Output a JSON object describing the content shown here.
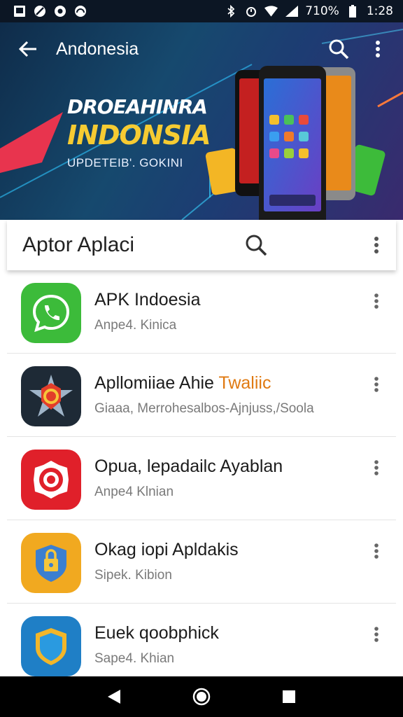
{
  "status_bar": {
    "battery": "710%",
    "time": "1:28"
  },
  "app_bar": {
    "title": "Andonesia",
    "back_icon": "back-arrow-icon",
    "search_icon": "search-icon",
    "menu_icon": "more-vert-icon"
  },
  "hero": {
    "line1": "DROEAHINRA",
    "line2": "INDONSIA",
    "line3": "UPDETEIB'. GOKINI"
  },
  "search": {
    "title": "Aptor Aplaci"
  },
  "apps": [
    {
      "name": "APK Indoesia",
      "name_accent": "",
      "sub": "Anpe4. Kinica",
      "icon": "phone-icon",
      "color": "#3cbb3a"
    },
    {
      "name": "Apllomiiae Ahie ",
      "name_accent": "Twaliic",
      "sub": "Giaaa, Merrohesalbos-Ajnjuss,/Soola",
      "icon": "star-shield-icon",
      "color": "#1e2a36"
    },
    {
      "name": "Opua, lepadailc Ayablan",
      "name_accent": "",
      "sub": "Anpe4 Klnian",
      "icon": "target-icon",
      "color": "#e0202a"
    },
    {
      "name": "Okag iopi Apldakis",
      "name_accent": "",
      "sub": "Sipek. Kibion",
      "icon": "lock-shield-icon",
      "color": "#f1a920"
    },
    {
      "name": "Euek qoobphick",
      "name_accent": "",
      "sub": "Sape4. Khian",
      "icon": "shield-icon",
      "color": "#1f7fc6"
    }
  ],
  "colors": {
    "accent": "#e07a12",
    "hero_yellow": "#f6cb32"
  }
}
